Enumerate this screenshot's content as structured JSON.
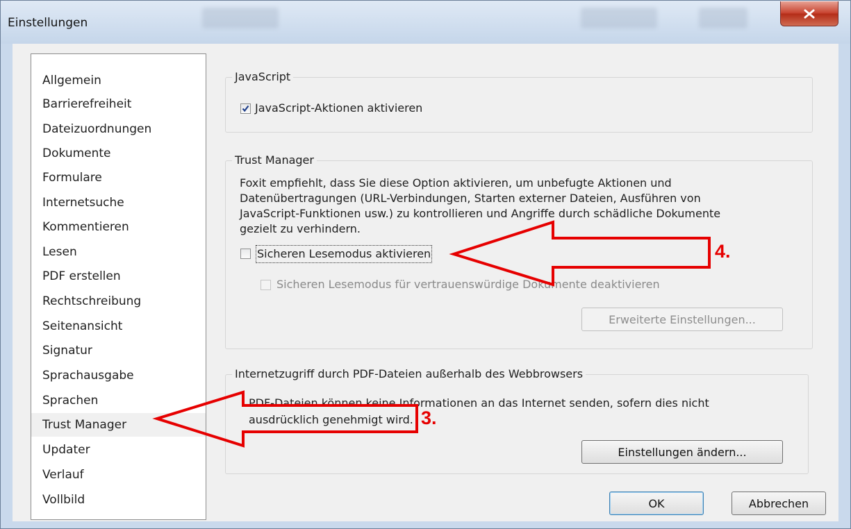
{
  "window": {
    "title": "Einstellungen"
  },
  "sidebar": {
    "items": [
      {
        "label": "Allgemein"
      },
      {
        "label": "Barrierefreiheit"
      },
      {
        "label": "Dateizuordnungen"
      },
      {
        "label": "Dokumente"
      },
      {
        "label": "Formulare"
      },
      {
        "label": "Internetsuche"
      },
      {
        "label": "Kommentieren"
      },
      {
        "label": "Lesen"
      },
      {
        "label": "PDF erstellen"
      },
      {
        "label": "Rechtschreibung"
      },
      {
        "label": "Seitenansicht"
      },
      {
        "label": "Signatur"
      },
      {
        "label": "Sprachausgabe"
      },
      {
        "label": "Sprachen"
      },
      {
        "label": "Trust Manager",
        "selected": true
      },
      {
        "label": "Updater"
      },
      {
        "label": "Verlauf"
      },
      {
        "label": "Vollbild"
      }
    ]
  },
  "javascript": {
    "title": "JavaScript",
    "enable_label": "JavaScript-Aktionen aktivieren",
    "enable_checked": true
  },
  "trust_manager": {
    "title": "Trust Manager",
    "description": [
      "Foxit empfiehlt, dass Sie diese Option aktivieren, um unbefugte Aktionen und",
      "Datenübertragungen (URL-Verbindungen, Starten externer Dateien, Ausführen von",
      "JavaScript-Funktionen usw.) zu kontrollieren und Angriffe durch schädliche Dokumente",
      "gezielt zu verhindern."
    ],
    "safe_mode_label": "Sicheren Lesemodus aktivieren",
    "safe_mode_checked": false,
    "trusted_docs_label": "Sicheren Lesemodus für vertrauenswürdige Dokumente deaktivieren",
    "trusted_docs_checked": false,
    "advanced_button": "Erweiterte Einstellungen..."
  },
  "internet_access": {
    "title": "Internetzugriff durch PDF-Dateien außerhalb des Webbrowsers",
    "description": [
      "PDF-Dateien können keine Informationen an das Internet senden, sofern dies nicht",
      "ausdrücklich genehmigt wird."
    ],
    "change_button": "Einstellungen ändern..."
  },
  "footer": {
    "ok_label": "OK",
    "cancel_label": "Abbrechen"
  },
  "annotations": {
    "step3": "3.",
    "step4": "4.",
    "color": "#e60000"
  }
}
